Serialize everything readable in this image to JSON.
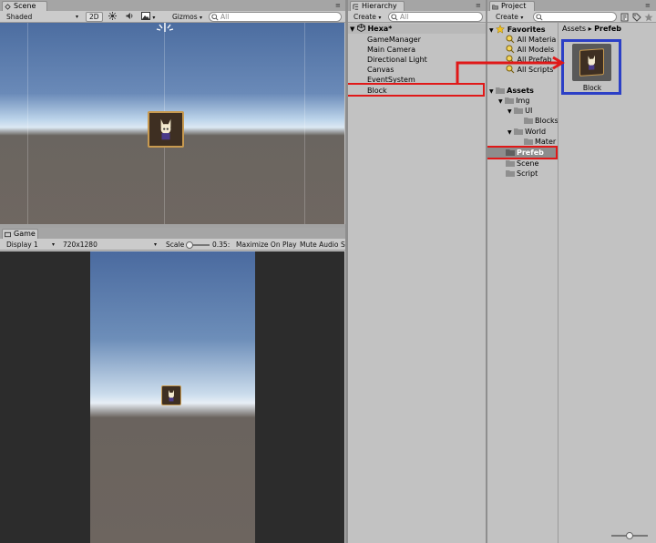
{
  "scene": {
    "tab_label": "Scene",
    "toolbar": {
      "shading_mode": "Shaded",
      "mode_2d": "2D",
      "gizmos_label": "Gizmos",
      "search_placeholder": "All"
    }
  },
  "game": {
    "tab_label": "Game",
    "toolbar": {
      "display": "Display 1",
      "resolution": "720x1280",
      "scale_label": "Scale",
      "scale_value": "0.35:",
      "maximize_label": "Maximize On Play",
      "mute_label": "Mute Audio",
      "stats_label": "S"
    }
  },
  "hierarchy": {
    "tab_label": "Hierarchy",
    "create_label": "Create",
    "search_placeholder": "All",
    "scene_name": "Hexa*",
    "items": [
      {
        "label": "GameManager"
      },
      {
        "label": "Main Camera"
      },
      {
        "label": "Directional Light"
      },
      {
        "label": "Canvas"
      },
      {
        "label": "EventSystem"
      },
      {
        "label": "Block"
      }
    ]
  },
  "project": {
    "tab_label": "Project",
    "create_label": "Create",
    "breadcrumb": {
      "root": "Assets",
      "separator": "▸",
      "current": "Prefeb"
    },
    "favorites_label": "Favorites",
    "favorites": [
      {
        "label": "All Materia"
      },
      {
        "label": "All Models"
      },
      {
        "label": "All Prefab"
      },
      {
        "label": "All Scripts"
      }
    ],
    "assets_label": "Assets",
    "tree": [
      {
        "label": "Img"
      },
      {
        "label": "UI"
      },
      {
        "label": "Blocks"
      },
      {
        "label": "World"
      },
      {
        "label": "Mater"
      },
      {
        "label": "Prefeb"
      },
      {
        "label": "Scene"
      },
      {
        "label": "Script"
      }
    ],
    "asset_item": {
      "label": "Block"
    }
  },
  "colors": {
    "highlight_red": "#e01818",
    "highlight_blue": "#2b3fc6",
    "folder": "#8f8f8f",
    "favorite_star": "#f0c020"
  },
  "icons": [
    "scene-tab-icon",
    "game-tab-icon",
    "hierarchy-tab-icon",
    "project-tab-icon",
    "sun-icon",
    "speaker-icon",
    "image-icon",
    "search-icon",
    "folder-icon",
    "star-icon",
    "lock-icon",
    "tag-icon",
    "red-arrow"
  ]
}
